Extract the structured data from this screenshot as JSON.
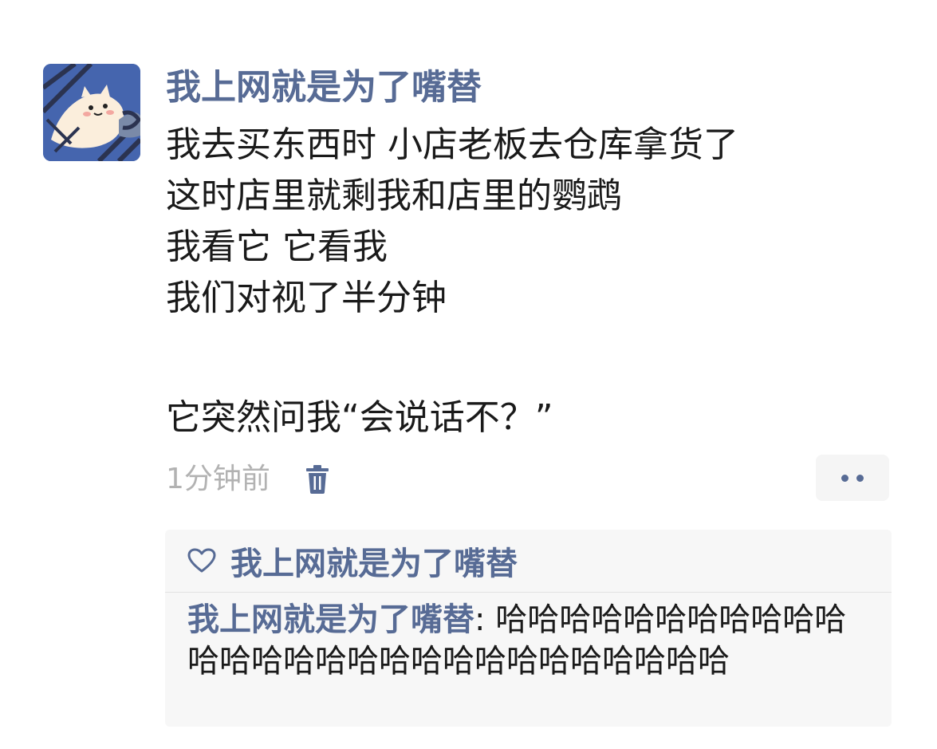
{
  "post": {
    "author": "我上网就是为了嘴替",
    "lines": [
      "我去买东西时 小店老板去仓库拿货了",
      "这时店里就剩我和店里的鹦鹉",
      "我看它 它看我",
      "我们对视了半分钟",
      "",
      "它突然问我“会说话不？”"
    ],
    "time": "1分钟前"
  },
  "icons": {
    "avatar": "cartoon-cat-avatar",
    "delete": "trash-icon",
    "more": "more-dots-icon",
    "like": "heart-outline-icon"
  },
  "likes": {
    "names": "我上网就是为了嘴替"
  },
  "comments": [
    {
      "author": "我上网就是为了嘴替",
      "separator": ": ",
      "text": "哈哈哈哈哈哈哈哈哈哈哈哈哈哈哈哈哈哈哈哈哈哈哈哈哈哈哈哈"
    }
  ],
  "colors": {
    "link": "#576b95",
    "text": "#1a1a1a",
    "muted": "#b2b2b2",
    "panel": "#f7f7f7"
  }
}
